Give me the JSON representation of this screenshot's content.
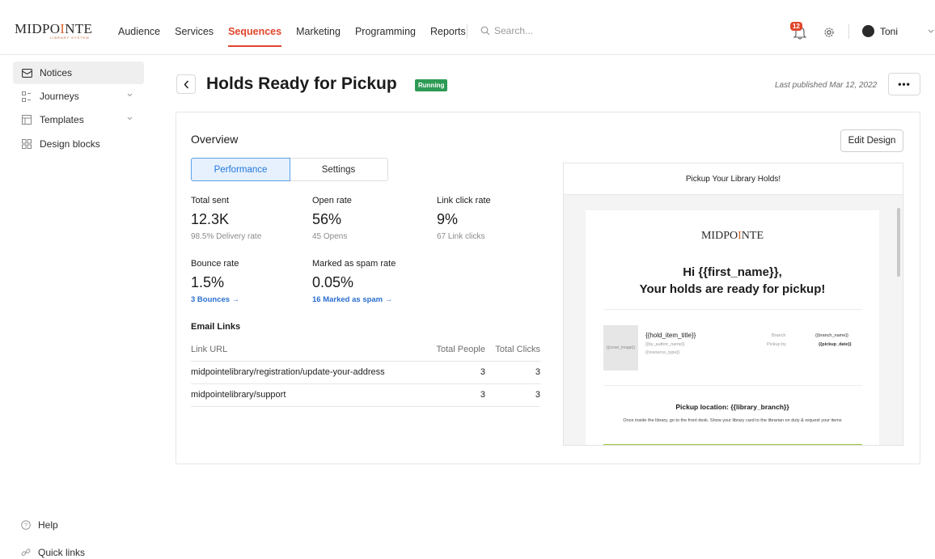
{
  "brand": {
    "logo_pre": "MIDPO",
    "logo_mid": "I",
    "logo_post": "NTE",
    "logo_sub": "LIBRARY SYSTEM",
    "accent": "#e0462b",
    "logo_orange": "#d9642b"
  },
  "nav": {
    "items": [
      "Audience",
      "Services",
      "Sequences",
      "Marketing",
      "Programming",
      "Reports"
    ],
    "active": "Sequences",
    "search_placeholder": "Search...",
    "notification_count": "12",
    "user_name": "Toni"
  },
  "sidebar": {
    "items": [
      {
        "label": "Notices",
        "icon": "envelope-icon"
      },
      {
        "label": "Journeys",
        "icon": "journeys-icon"
      },
      {
        "label": "Templates",
        "icon": "template-icon"
      },
      {
        "label": "Design blocks",
        "icon": "blocks-icon"
      }
    ],
    "bottom": [
      {
        "label": "Help",
        "icon": "help-icon"
      },
      {
        "label": "Quick links",
        "icon": "link-icon"
      }
    ]
  },
  "page": {
    "title": "Holds Ready for Pickup",
    "status": "Running",
    "status_color": "#2e9b55",
    "last_published": "Last published Mar 12, 2022",
    "more": "•••"
  },
  "overview": {
    "title": "Overview",
    "edit_button": "Edit Design",
    "tabs": [
      "Performance",
      "Settings"
    ],
    "metrics": {
      "total_sent": {
        "label": "Total sent",
        "value": "12.3K",
        "sub": "98.5% Delivery rate"
      },
      "open_rate": {
        "label": "Open rate",
        "value": "56%",
        "sub": "45 Opens"
      },
      "link_click_rate": {
        "label": "Link click rate",
        "value": "9%",
        "sub": "67 Link clicks"
      },
      "bounce_rate": {
        "label": "Bounce rate",
        "value": "1.5%",
        "link": "3 Bounces →"
      },
      "spam_rate": {
        "label": "Marked as spam rate",
        "value": "0.05%",
        "link": "16 Marked as spam →"
      }
    },
    "email_links": {
      "title": "Email Links",
      "headers": [
        "Link URL",
        "Total People",
        "Total Clicks"
      ],
      "rows": [
        [
          "midpointelibrary/registration/update-your-address",
          "3",
          "3"
        ],
        [
          "midpointelibrary/support",
          "3",
          "3"
        ]
      ]
    }
  },
  "preview": {
    "subject": "Pickup Your Library Holds!",
    "greeting_1": "Hi {{first_name}},",
    "greeting_2": "Your holds are ready for pickup!",
    "cover": "{{cover_image}}",
    "hold_item_title": "{{hold_item_title}}",
    "author": "{{by_author_name}}",
    "resource_type": "{{resource_type}}",
    "branch_label": "Branch",
    "branch_value": "{{branch_name}}",
    "pickup_label": "Pickup by",
    "pickup_value": "{{pickup_date}}",
    "pickup_location": "Pickup location: {{library_branch}}",
    "pickup_text": "Once inside the library, go to the front desk. Show your library card to the librarian on duty & request your items",
    "bar_color": "#9bc53d"
  }
}
